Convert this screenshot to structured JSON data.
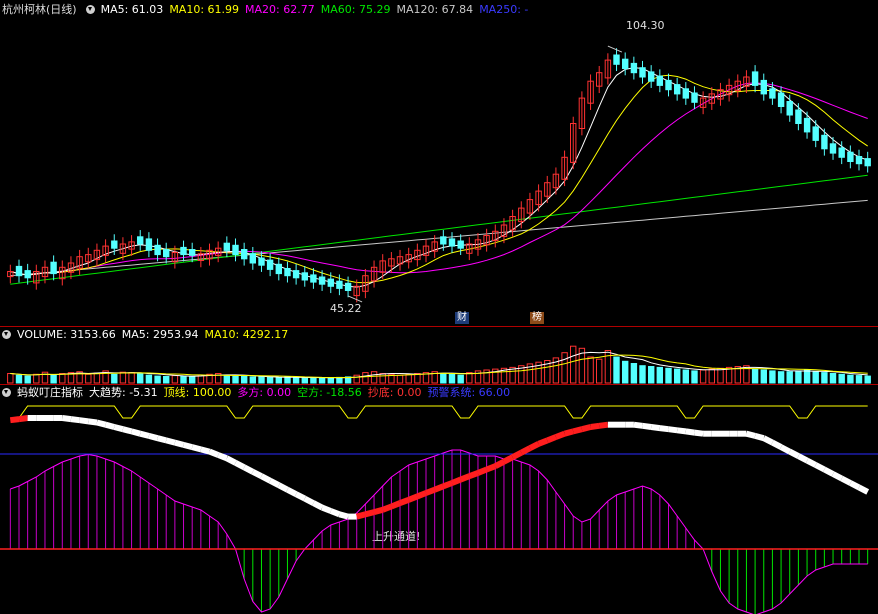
{
  "price_header": {
    "title": "杭州柯林(日线)",
    "ma5": "MA5: 61.03",
    "ma10": "MA10: 61.99",
    "ma20": "MA20: 62.77",
    "ma60": "MA60: 75.29",
    "ma120": "MA120: 67.84",
    "ma250": "MA250: -"
  },
  "volume_header": {
    "title": "VOLUME: 3153.66",
    "ma5": "MA5: 2953.94",
    "ma10": "MA10: 4292.17"
  },
  "indicator_header": {
    "title": "蚂蚁叮庄指标",
    "trend": "大趋势: -5.31",
    "top": "顶线: 100.00",
    "bull": "多方: 0.00",
    "bear": "空方: -18.56",
    "bottom": "抄底: 0.00",
    "alert": "预警系统: 66.00"
  },
  "annotations": {
    "high": "104.30",
    "low": "45.22",
    "channel": "上升通道!",
    "badge_cai": "财",
    "badge_bang": "榜"
  },
  "colors": {
    "up": "#ff3232",
    "down": "#54ffff",
    "ma5": "#ffffff",
    "ma10": "#ffff00",
    "ma20": "#ff00ff",
    "ma60": "#00e600",
    "ma120": "#c8c8c8",
    "separator": "#b00000"
  },
  "chart_data": {
    "type": "candlestick",
    "stock": "杭州柯林",
    "period": "日线",
    "close": [
      51,
      50,
      49.5,
      51,
      52,
      50.5,
      52,
      53,
      54.5,
      55,
      56,
      57,
      56.5,
      57.5,
      58,
      57.5,
      56,
      55,
      54.5,
      55.5,
      55,
      54.8,
      55.2,
      56,
      56.5,
      56,
      55,
      54,
      53,
      52.5,
      51.5,
      50.5,
      50,
      49.5,
      49,
      48.5,
      48,
      47.5,
      47,
      46.5,
      47.5,
      50,
      52,
      53.5,
      54,
      54.5,
      55,
      56,
      57,
      58,
      57.5,
      57,
      56.5,
      57.5,
      58.5,
      59.5,
      60.5,
      62,
      64,
      66,
      68,
      70,
      72,
      74,
      78,
      86,
      92,
      96,
      98,
      101,
      100,
      99,
      98,
      97,
      96,
      95,
      94,
      93,
      92,
      91,
      92,
      93,
      94,
      95,
      96,
      97,
      95,
      93,
      92,
      90,
      88,
      86,
      84,
      82,
      80,
      79,
      78,
      77,
      76.5,
      76
    ],
    "candle_up": [
      true,
      false,
      false,
      true,
      true,
      false,
      true,
      true,
      true,
      true,
      true,
      true,
      false,
      true,
      true,
      false,
      false,
      false,
      false,
      true,
      false,
      false,
      true,
      true,
      true,
      false,
      false,
      false,
      false,
      false,
      false,
      false,
      false,
      false,
      false,
      false,
      false,
      false,
      false,
      false,
      true,
      true,
      true,
      true,
      true,
      true,
      true,
      true,
      true,
      true,
      false,
      false,
      false,
      true,
      true,
      true,
      true,
      true,
      true,
      true,
      true,
      true,
      true,
      true,
      true,
      true,
      true,
      true,
      true,
      true,
      false,
      false,
      false,
      false,
      false,
      false,
      false,
      false,
      false,
      false,
      true,
      true,
      true,
      true,
      true,
      true,
      false,
      false,
      false,
      false,
      false,
      false,
      false,
      false,
      false,
      false,
      false,
      false,
      false,
      false
    ],
    "ma_values": {
      "MA5": 61.03,
      "MA10": 61.99,
      "MA20": 62.77,
      "MA60": 75.29,
      "MA120": 67.84
    },
    "high": 104.3,
    "low": 45.22,
    "volume": {
      "VOLUME": 3153.66,
      "MA5": 2953.94,
      "MA10": 4292.17,
      "bars": [
        22,
        18,
        16,
        20,
        25,
        18,
        22,
        24,
        26,
        20,
        23,
        28,
        20,
        25,
        24,
        22,
        18,
        16,
        15,
        17,
        16,
        15,
        18,
        20,
        22,
        18,
        16,
        15,
        14,
        14,
        13,
        12,
        14,
        13,
        12,
        12,
        11,
        12,
        13,
        14,
        18,
        24,
        26,
        22,
        20,
        18,
        20,
        22,
        24,
        26,
        22,
        20,
        18,
        24,
        28,
        30,
        32,
        34,
        36,
        40,
        44,
        48,
        52,
        58,
        70,
        85,
        80,
        60,
        55,
        75,
        60,
        50,
        45,
        40,
        38,
        36,
        34,
        32,
        30,
        28,
        30,
        32,
        34,
        36,
        38,
        40,
        32,
        30,
        28,
        26,
        26,
        28,
        30,
        26,
        24,
        22,
        20,
        18,
        17,
        16
      ]
    },
    "indicator": {
      "大趋势": -5.31,
      "顶线": 100.0,
      "多方": 0.0,
      "空方": -18.56,
      "抄底": 0.0,
      "预警系统": 66.0,
      "trend": [
        98,
        99,
        100,
        100,
        100,
        100,
        100,
        99,
        98,
        97,
        96,
        94,
        92,
        90,
        88,
        86,
        84,
        82,
        80,
        78,
        76,
        74,
        72,
        70,
        67,
        64,
        60,
        56,
        52,
        48,
        44,
        40,
        36,
        32,
        28,
        24,
        20,
        17,
        14,
        12,
        12,
        14,
        16,
        18,
        21,
        24,
        27,
        30,
        33,
        36,
        39,
        42,
        45,
        48,
        51,
        54,
        57,
        61,
        65,
        69,
        73,
        77,
        80,
        83,
        86,
        88,
        90,
        92,
        93,
        94,
        94,
        94,
        94,
        93,
        92,
        91,
        90,
        89,
        88,
        87,
        86,
        86,
        86,
        86,
        86,
        86,
        84,
        82,
        78,
        74,
        70,
        66,
        62,
        58,
        54,
        50,
        46,
        42,
        38,
        34
      ],
      "hist": [
        40,
        42,
        45,
        48,
        52,
        55,
        58,
        60,
        62,
        63,
        62,
        60,
        58,
        55,
        52,
        48,
        44,
        40,
        36,
        32,
        30,
        28,
        26,
        22,
        18,
        10,
        0,
        -20,
        -35,
        -42,
        -40,
        -32,
        -20,
        -8,
        0,
        6,
        12,
        16,
        18,
        20,
        24,
        30,
        36,
        42,
        48,
        52,
        56,
        58,
        60,
        62,
        64,
        66,
        66,
        64,
        62,
        62,
        62,
        60,
        60,
        58,
        56,
        52,
        46,
        38,
        30,
        22,
        18,
        20,
        26,
        32,
        36,
        38,
        40,
        42,
        40,
        36,
        30,
        22,
        14,
        6,
        0,
        -15,
        -28,
        -36,
        -40,
        -42,
        -44,
        -42,
        -40,
        -36,
        -30,
        -24,
        -18,
        -14,
        -12,
        -10,
        -10,
        -10,
        -10,
        -10
      ]
    }
  }
}
